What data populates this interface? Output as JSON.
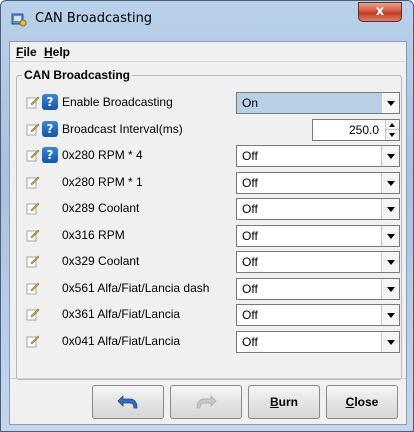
{
  "window": {
    "title": "CAN Broadcasting",
    "close_label": "x"
  },
  "menu": [
    {
      "label_acc": "F",
      "label_rest": "ile"
    },
    {
      "label_acc": "H",
      "label_rest": "elp"
    }
  ],
  "group": {
    "title": "CAN Broadcasting"
  },
  "rows": [
    {
      "label": "Enable Broadcasting",
      "has_help": true,
      "control": "combo",
      "value": "On",
      "highlight": true
    },
    {
      "label": "Broadcast Interval(ms)",
      "has_help": true,
      "control": "spinner",
      "value": "250.0"
    },
    {
      "label": "0x280 RPM * 4",
      "has_help": true,
      "control": "combo",
      "value": "Off"
    },
    {
      "label": "0x280 RPM * 1",
      "has_help": false,
      "control": "combo",
      "value": "Off"
    },
    {
      "label": "0x289 Coolant",
      "has_help": false,
      "control": "combo",
      "value": "Off"
    },
    {
      "label": "0x316 RPM",
      "has_help": false,
      "control": "combo",
      "value": "Off"
    },
    {
      "label": "0x329 Coolant",
      "has_help": false,
      "control": "combo",
      "value": "Off"
    },
    {
      "label": "0x561 Alfa/Fiat/Lancia dash",
      "has_help": false,
      "control": "combo",
      "value": "Off"
    },
    {
      "label": "0x361 Alfa/Fiat/Lancia",
      "has_help": false,
      "control": "combo",
      "value": "Off"
    },
    {
      "label": "0x041 Alfa/Fiat/Lancia",
      "has_help": false,
      "control": "combo",
      "value": "Off"
    }
  ],
  "buttons": {
    "burn_acc": "B",
    "burn_rest": "urn",
    "close_acc": "C",
    "close_rest": "lose"
  },
  "colors": {
    "help_icon": "#1a6cc8",
    "highlight_combo": "#b8cfe5"
  }
}
